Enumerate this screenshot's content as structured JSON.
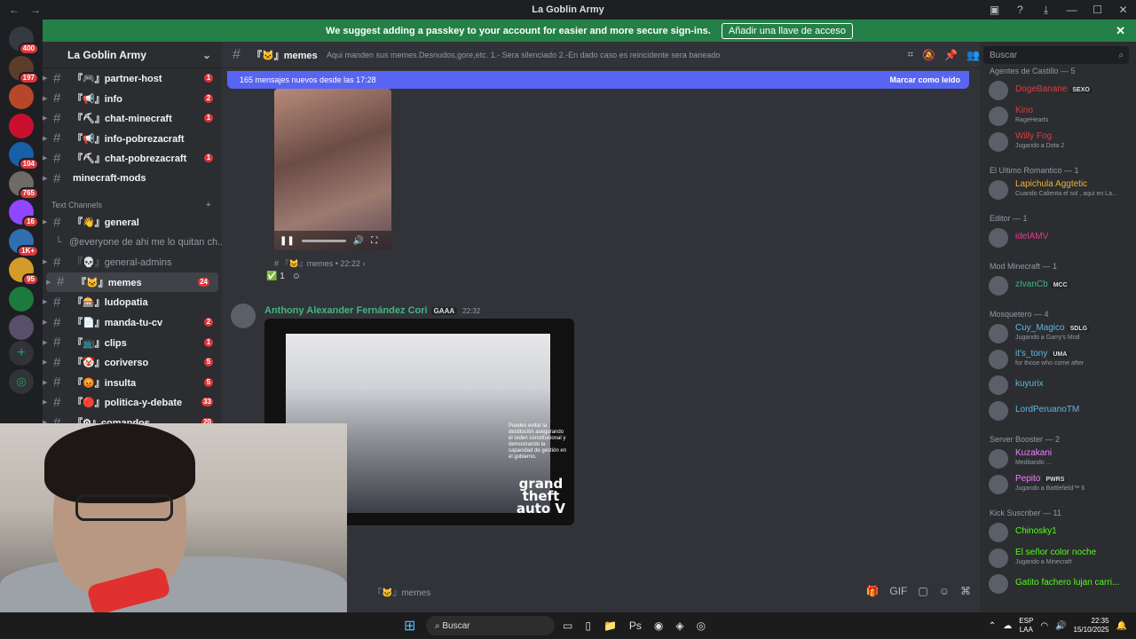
{
  "window": {
    "title": "La Goblin Army",
    "back": "←",
    "forward": "→"
  },
  "banner": {
    "text": "We suggest adding a passkey to your account for easier and more secure sign-ins.",
    "button": "Añadir una llave de acceso",
    "close": "✕"
  },
  "guilds": [
    {
      "name": "guild-1",
      "badge": "400",
      "color": "#36393f"
    },
    {
      "name": "guild-2",
      "badge": "197",
      "color": "#5a3d2b"
    },
    {
      "name": "guild-3",
      "badge": "",
      "color": "#b8472a"
    },
    {
      "name": "guild-4",
      "badge": "",
      "color": "#c8102e"
    },
    {
      "name": "guild-5",
      "badge": "104",
      "color": "#1560a8"
    },
    {
      "name": "guild-6",
      "badge": "765",
      "color": "#6e6a66"
    },
    {
      "name": "guild-7",
      "badge": "16",
      "color": "#9146ff"
    },
    {
      "name": "guild-8",
      "badge": "1K+",
      "color": "#2f6fb0"
    },
    {
      "name": "guild-9",
      "badge": "95",
      "color": "#d49b2a"
    },
    {
      "name": "guild-10",
      "badge": "",
      "color": "#1c7a3c"
    },
    {
      "name": "guild-11",
      "badge": "",
      "color": "#584f6a"
    }
  ],
  "server": {
    "name": "La Goblin Army",
    "chevron": "⌄"
  },
  "channels": [
    {
      "name": "『🎮』partner-host",
      "count": "1",
      "unread": true
    },
    {
      "name": "『📢』info",
      "count": "2",
      "unread": true
    },
    {
      "name": "『⛏』chat-minecraft",
      "count": "1",
      "unread": true
    },
    {
      "name": "『📢』info-pobrezacraft",
      "count": "",
      "unread": true
    },
    {
      "name": "『⛏』chat-pobrezacraft",
      "count": "1",
      "unread": true
    },
    {
      "name": "minecraft-mods",
      "count": "",
      "unread": true
    }
  ],
  "text_channels_label": "Text Channels",
  "channels2": [
    {
      "name": "『👋』general",
      "count": "",
      "unread": true
    },
    {
      "name": "@everyone de ahi me lo quitan ch...",
      "count": "",
      "unread": false,
      "thread": true
    },
    {
      "name": "『💀』general-admins",
      "count": "",
      "unread": false
    },
    {
      "name": "『🐱』memes",
      "count": "24",
      "unread": true,
      "selected": true
    },
    {
      "name": "『🎰』ludopatia",
      "count": "",
      "unread": true
    },
    {
      "name": "『📄』manda-tu-cv",
      "count": "2",
      "unread": true
    },
    {
      "name": "『📺』clips",
      "count": "1",
      "unread": true
    },
    {
      "name": "『🤡』coriverso",
      "count": "5",
      "unread": true
    },
    {
      "name": "『😡』insulta",
      "count": "5",
      "unread": true
    },
    {
      "name": "『🔴』politica-y-debate",
      "count": "33",
      "unread": true
    },
    {
      "name": "『⚙』comandos",
      "count": "20",
      "unread": true
    }
  ],
  "chat": {
    "channel": "『🐱』memes",
    "topic": "Aqui manden sus memes.Desnudos,gore,etc. 1.- Sera silenciado 2.-En dado caso es reincidente sera baneado",
    "unread_bar": "165 mensajes nuevos desde las 17:28",
    "mark_read": "Marcar como leído",
    "video_meta": "# 『🐱』memes • 22:22 ›",
    "reaction_emoji": "✅",
    "reaction_count": "1",
    "message2": {
      "author": "Anthony Alexander Fernández Cori",
      "tag": "GAAA",
      "time": "22:32",
      "caption": "Puedes evitar la destitución asegurando el orden constitucional y demostrando la capacidad de gestión en el gobierno.",
      "logo": "grand theft auto V"
    },
    "composer_placeholder": "『🐱』memes"
  },
  "members": {
    "search_placeholder": "Buscar",
    "groups": [
      {
        "label": "Agentes de Castillo — 5",
        "items": [
          {
            "name": "DogeBanane",
            "pill": "SEXO",
            "status": "",
            "color": "#e03c3c"
          },
          {
            "name": "Kino",
            "pill": "",
            "status": "RageHearts",
            "color": "#e03c3c"
          },
          {
            "name": "Willy Fog",
            "pill": "",
            "status": "Jugando a Dota 2",
            "color": "#e03c3c"
          }
        ]
      },
      {
        "label": "El Ultimo Romantico — 1",
        "items": [
          {
            "name": "Lapichula Aggtetic",
            "pill": "",
            "status": "Cuando Calienta el sol , aqui en La...",
            "color": "#f0b232"
          }
        ]
      },
      {
        "label": "Editor — 1",
        "items": [
          {
            "name": "idelAMV",
            "pill": "",
            "status": "",
            "color": "#e03c8c"
          }
        ]
      },
      {
        "label": "Mod Minecraft — 1",
        "items": [
          {
            "name": "zIvanCb",
            "pill": "MCC",
            "status": "",
            "color": "#43b581"
          }
        ]
      },
      {
        "label": "Mosquetero — 4",
        "items": [
          {
            "name": "Cuy_Magico",
            "pill": "SDLG",
            "status": "Jugando a Garry's Mod",
            "color": "#5cb8e4"
          },
          {
            "name": "it's_tony",
            "pill": "UMA",
            "status": "for those who come after",
            "color": "#5cb8e4"
          },
          {
            "name": "kuyurix",
            "pill": "",
            "status": "",
            "color": "#5cb8e4"
          },
          {
            "name": "LordPeruanoTM",
            "pill": "",
            "status": "",
            "color": "#5cb8e4"
          }
        ]
      },
      {
        "label": "Server Booster — 2",
        "items": [
          {
            "name": "Kuzakani",
            "pill": "",
            "status": "Meditando ...",
            "color": "#f47fff"
          },
          {
            "name": "Pepito",
            "pill": "PWRS",
            "status": "Jugando a Battlefield™ 6",
            "color": "#f47fff"
          }
        ]
      },
      {
        "label": "Kick Suscriber — 11",
        "items": [
          {
            "name": "Chinosky1",
            "pill": "",
            "status": "",
            "color": "#53fc18"
          },
          {
            "name": "El señor color noche",
            "pill": "",
            "status": "Jugando a Minecraft",
            "color": "#53fc18"
          },
          {
            "name": "Gatito fachero lujan carri...",
            "pill": "",
            "status": "",
            "color": "#53fc18"
          }
        ]
      }
    ]
  },
  "taskbar": {
    "search": "Buscar",
    "lang1": "ESP",
    "lang2": "LAA",
    "time": "22:35",
    "date": "15/10/2025"
  }
}
